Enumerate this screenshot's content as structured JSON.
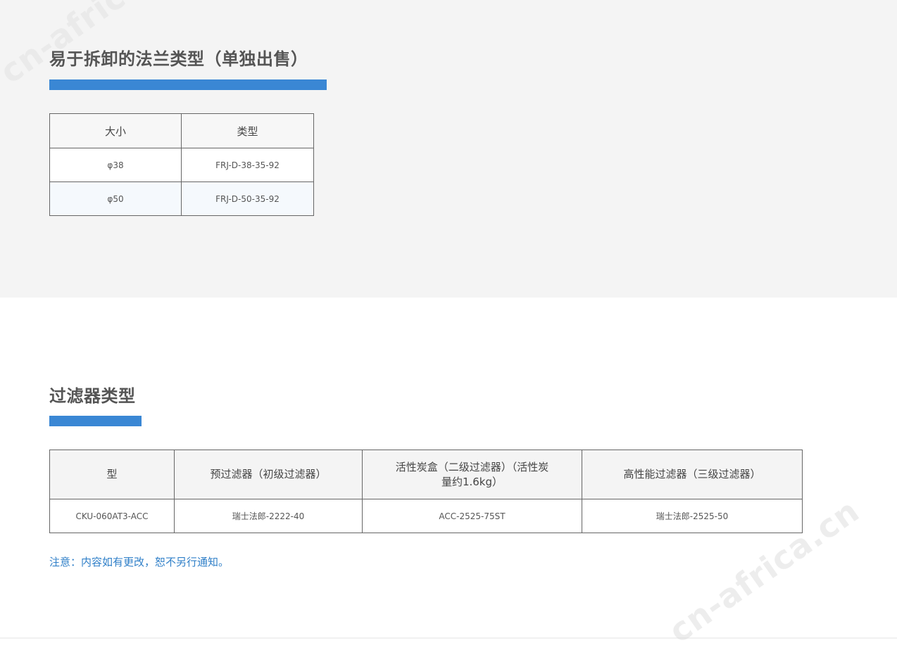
{
  "section_flange": {
    "title": "易于拆卸的法兰类型（单独出售）",
    "table": {
      "headers": [
        "大小",
        "类型"
      ],
      "rows": [
        [
          "φ38",
          "FRJ-D-38-35-92"
        ],
        [
          "φ50",
          "FRJ-D-50-35-92"
        ]
      ]
    }
  },
  "section_filter": {
    "title": "过滤器类型",
    "table": {
      "headers": [
        "型",
        "预过滤器（初级过滤器）",
        "活性炭盒（二级过滤器）（活性炭量约1.6kg）",
        "高性能过滤器（三级过滤器）"
      ],
      "rows": [
        [
          "CKU-060AT3-ACC",
          "瑞士法郎-2222-40",
          "ACC-2525-75ST",
          "瑞士法郎-2525-50"
        ]
      ]
    },
    "note": "注意：内容如有更改，恕不另行通知。"
  },
  "watermark": {
    "text": "cn-africa.cn"
  },
  "colors": {
    "accent": "#3a87d4",
    "note": "#2f7fc8",
    "top_background": "#f4f4f4",
    "heading": "#555555"
  }
}
